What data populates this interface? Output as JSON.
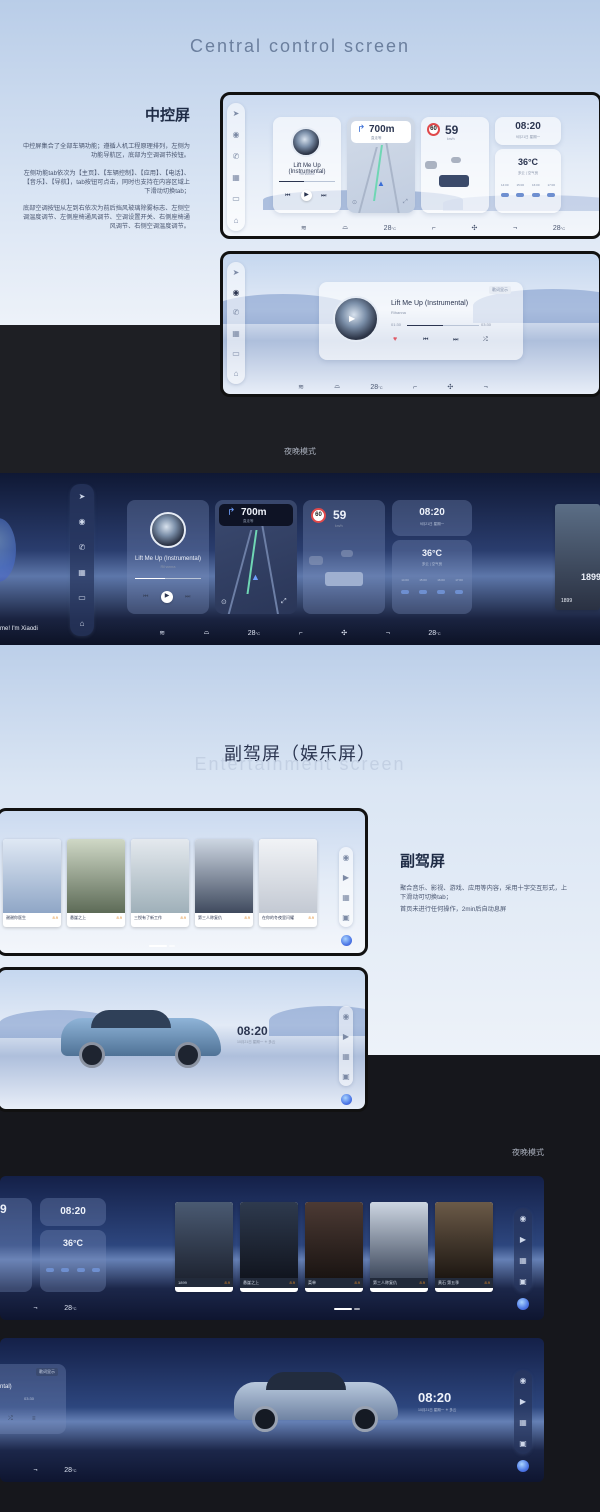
{
  "section1": {
    "title_en": "Central control screen",
    "side_title": "中控屏",
    "paragraphs": [
      "中控屏集合了全部车辆功能；遵循人机工程原理排列，左侧为功能导航区，底部为空调调节按钮。",
      "左侧功能tab依次为【主页】、【车辆控制】、【应用】、【电话】、【音乐】、【导航】，tab按钮可点击，同时也支持在内容区域上下滑动切换tab；",
      "底部空调按钮从左到右依次为前后挡风玻璃除雾标志、左侧空调温度调节、左侧座椅通风调节、空调设置开关、右侧座椅通风调节、右侧空调温度调节。"
    ]
  },
  "widgets": {
    "song": "Lift Me Up (Instrumental)",
    "artist": "Rihanna",
    "nav_distance": "700m",
    "nav_sub": "直走等",
    "speed_limit": "60",
    "speed": "59",
    "speed_unit": "km/h",
    "time": "08:20",
    "date": "9月21日  星期一",
    "temp": "36°C",
    "temp_sub": "多云 | 空气良",
    "forecast": [
      "14:00",
      "15:00",
      "16:00",
      "17:00"
    ],
    "temp_left": "28",
    "temp_right": "28",
    "temp_unit": "°C",
    "time_start": "01:30",
    "time_end": "03:30",
    "lyrics_badge": "歌词显示"
  },
  "night_label": "夜晚模式",
  "assistant_text": "me! I'm Xiaodi",
  "movie_1899": "1899",
  "section2": {
    "title_cn": "副驾屏（娱乐屏）",
    "title_en": "Entertainment screen",
    "side_title": "副驾屏",
    "paragraphs": [
      "聚合音乐、影视、游戏、应用等内容，采用十字交互形式，上下滑动可切换tab；",
      "首页未进行任何操作，2min后自动息屏"
    ],
    "clock": "08:20",
    "clock_date": "10月21日  星期一  ☀ 多云"
  },
  "posters_light": [
    {
      "title": "谢谢你医生",
      "score": "8.9"
    },
    {
      "title": "悬崖之上",
      "score": "8.9"
    },
    {
      "title": "三悦有了新工作",
      "score": "8.9"
    },
    {
      "title": "第三人称复仇",
      "score": "8.9"
    },
    {
      "title": "在你的冬夜里闪耀",
      "score": "8.9"
    }
  ],
  "posters_dark": [
    {
      "title": "1899",
      "score": "8.9"
    },
    {
      "title": "悬崖之上",
      "score": "8.9"
    },
    {
      "title": "菜单",
      "score": "8.9"
    },
    {
      "title": "第三人称复仇",
      "score": "8.9"
    },
    {
      "title": "黄石 第五季",
      "score": "8.9"
    }
  ],
  "night_label_2": "夜晚模式",
  "dark_partial": {
    "speed_digit": "9",
    "clock": "08:20",
    "temp": "36°C",
    "temp_left": "28",
    "song_tail": "ntal)",
    "time_end": "03:30",
    "lyrics_badge": "歌词显示"
  },
  "colors": {
    "accent": "#6e8fd0",
    "route": "#6fd6b4",
    "score": "#e08a2b",
    "speed_limit_ring": "#e0494b"
  }
}
